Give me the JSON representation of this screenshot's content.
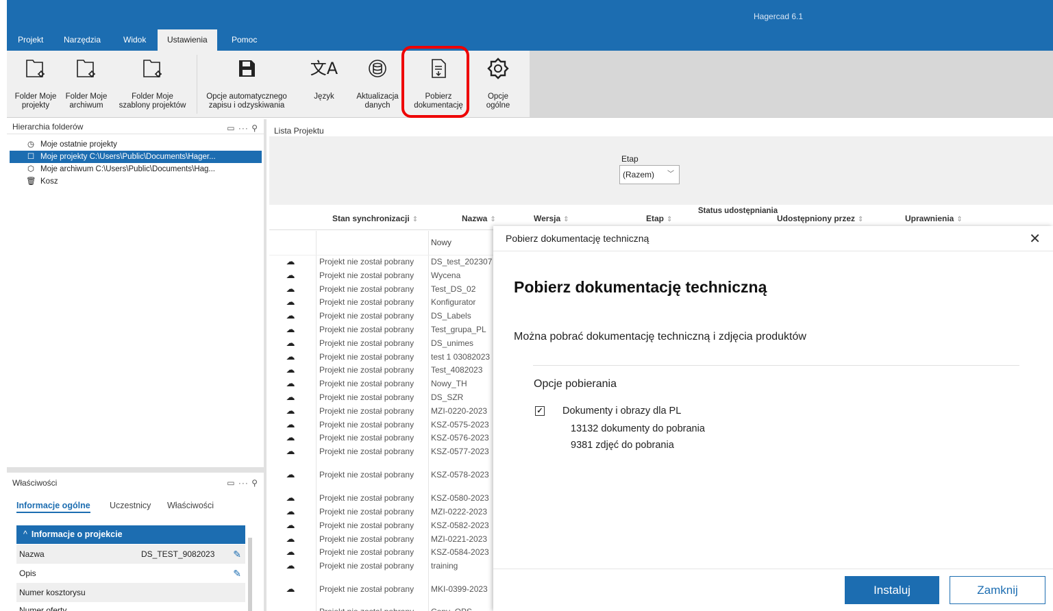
{
  "app_title": "Hagercad 6.1",
  "menu": [
    "Projekt",
    "Narzędzia",
    "Widok",
    "Ustawienia",
    "Pomoc"
  ],
  "active_menu": "Ustawienia",
  "ribbon": {
    "folder_projects": [
      "Folder Moje",
      "projekty"
    ],
    "folder_archive": [
      "Folder Moje",
      "archiwum"
    ],
    "folder_templates": [
      "Folder Moje",
      "szablony projektów"
    ],
    "autosave": [
      "Opcje automatycznego",
      "zapisu i odzyskiwania"
    ],
    "language": [
      "Język",
      ""
    ],
    "update_data": [
      "Aktualizacja",
      "danych"
    ],
    "download_docs": [
      "Pobierz",
      "dokumentację"
    ],
    "general_options": [
      "Opcje",
      "ogólne"
    ]
  },
  "folder_panel": {
    "title": "Hierarchia folderów",
    "items": [
      {
        "label": "Moje ostatnie projekty",
        "icon": "clock-icon"
      },
      {
        "label": "Moje projekty   C:\\Users\\Public\\Documents\\Hager...",
        "icon": "folder-icon"
      },
      {
        "label": "Moje archiwum   C:\\Users\\Public\\Documents\\Hag...",
        "icon": "archive-icon"
      },
      {
        "label": "Kosz",
        "icon": "trash-icon"
      }
    ]
  },
  "properties_panel": {
    "title": "Właściwości",
    "tabs": [
      "Informacje ogólne",
      "Uczestnicy",
      "Właściwości"
    ],
    "group": "Informacje o projekcie",
    "rows": [
      {
        "label": "Nazwa",
        "value": "DS_TEST_9082023"
      },
      {
        "label": "Opis",
        "value": ""
      },
      {
        "label": "Numer kosztorysu",
        "value": ""
      },
      {
        "label": "Numer oferty",
        "value": ""
      }
    ]
  },
  "list": {
    "title": "Lista Projektu",
    "filter_label": "Etap",
    "filter_value": "(Razem)",
    "columns": [
      "Stan synchronizacji",
      "Nazwa",
      "Wersja",
      "Etap",
      "Status udostępniania",
      "Udostępniony przez",
      "Uprawnienia"
    ],
    "new_row": "Nowy",
    "status_text": "Projekt nie został pobrany",
    "rows": [
      "DS_test_202307",
      "Wycena",
      "Test_DS_02",
      "Konfigurator",
      "DS_Labels",
      "Test_grupa_PL",
      "DS_unimes",
      "test 1 03082023",
      "Test_4082023",
      "Nowy_TH",
      "DS_SZR",
      "MZI-0220-2023",
      "KSZ-0575-2023",
      "KSZ-0576-2023",
      "KSZ-0577-2023",
      "KSZ-0578-2023",
      "KSZ-0580-2023",
      "MZI-0222-2023",
      "KSZ-0582-2023",
      "MZI-0221-2023",
      "KSZ-0584-2023",
      "training",
      "MKI-0399-2023",
      "Copy_OPS"
    ]
  },
  "dialog": {
    "title": "Pobierz dokumentację techniczną",
    "heading": "Pobierz dokumentację techniczną",
    "description": "Można pobrać dokumentację techniczną i zdjęcia produktów",
    "options_title": "Opcje pobierania",
    "checkbox_label": "Dokumenty i obrazy dla PL",
    "checked": true,
    "docs_count": "13132 dokumenty do pobrania",
    "pics_count": "9381 zdjęć do pobrania",
    "install_label": "Instaluj",
    "close_label": "Zamknij"
  },
  "colors": {
    "brand": "#1c6db1",
    "highlight": "#ee0000"
  }
}
